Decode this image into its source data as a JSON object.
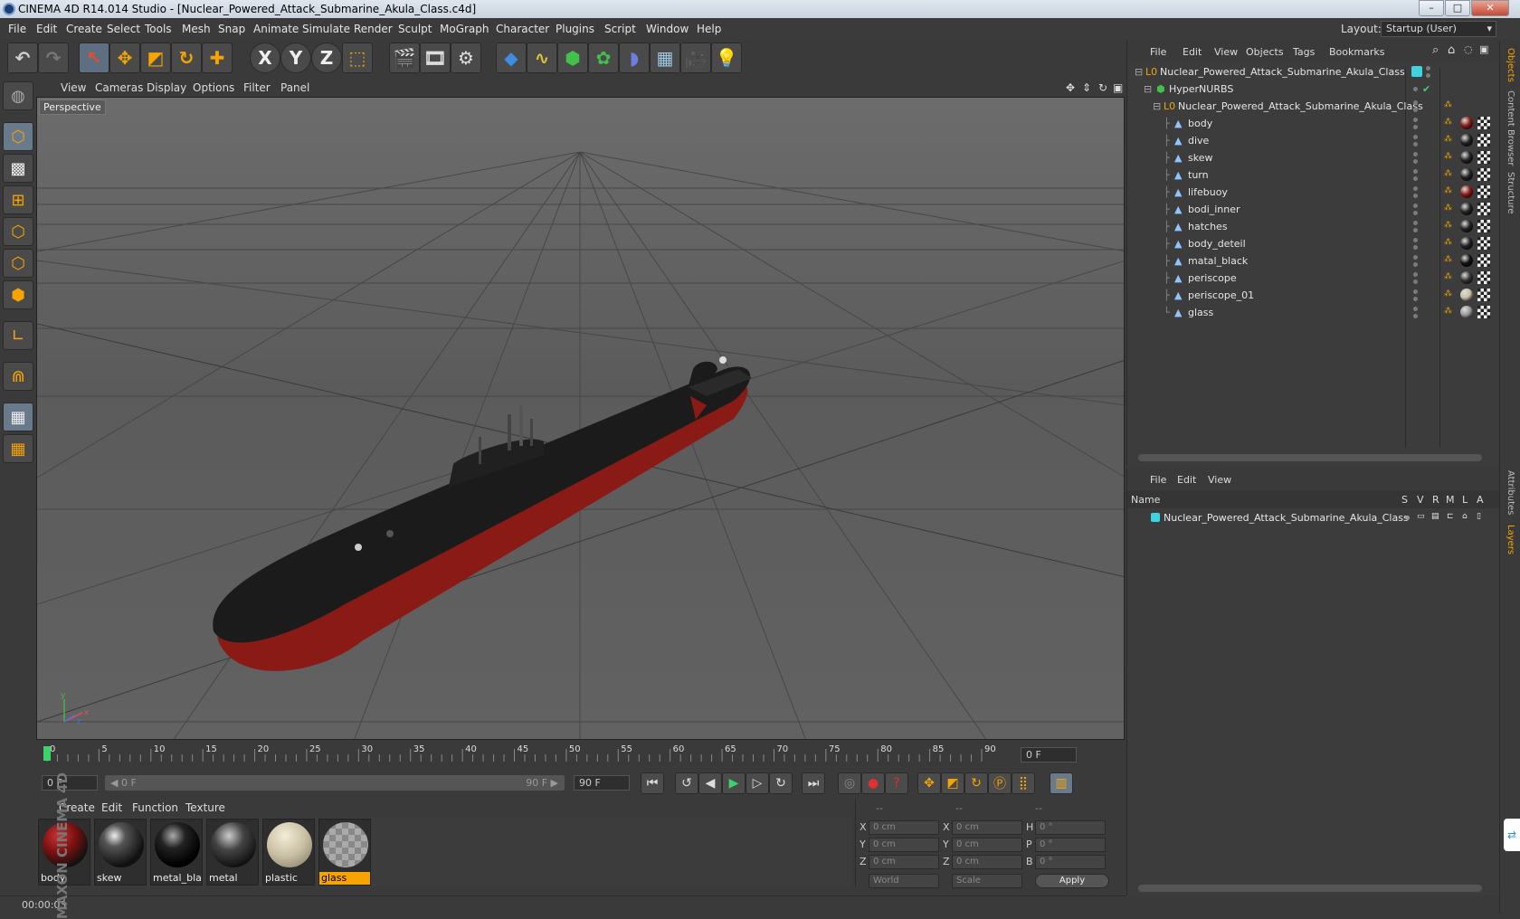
{
  "window": {
    "title": "CINEMA 4D R14.014 Studio - [Nuclear_Powered_Attack_Submarine_Akula_Class.c4d]",
    "minimize": "–",
    "maximize": "□",
    "close": "✕"
  },
  "menubar": {
    "items": [
      "File",
      "Edit",
      "Create",
      "Select",
      "Tools",
      "Mesh",
      "Snap",
      "Animate",
      "Simulate",
      "Render",
      "Sculpt",
      "MoGraph",
      "Character",
      "Plugins",
      "Script",
      "Window",
      "Help"
    ],
    "layout_label": "Layout:",
    "layout_value": "Startup (User)"
  },
  "toolbar": {
    "icons": [
      "undo-icon",
      "redo-icon",
      "live-select-icon",
      "move-icon",
      "scale-icon",
      "rotate-icon",
      "add-icon",
      "x-axis-icon",
      "y-axis-icon",
      "z-axis-icon",
      "coordinate-system-icon",
      "render-view-icon",
      "render-picture-viewer-icon",
      "edit-render-settings-icon",
      "cube-icon",
      "spline-pen-icon",
      "subdivision-icon",
      "array-icon",
      "deformer-icon",
      "floor-icon",
      "camera-icon",
      "light-icon"
    ],
    "axis_x": "X",
    "axis_y": "Y",
    "axis_z": "Z"
  },
  "viewport": {
    "menu": [
      "View",
      "Cameras",
      "Display",
      "Options",
      "Filter",
      "Panel"
    ],
    "label": "Perspective",
    "axis_x": "x",
    "axis_y": "y",
    "axis_z": "z"
  },
  "timeline": {
    "ticks": [
      "0",
      "5",
      "10",
      "15",
      "20",
      "25",
      "30",
      "35",
      "40",
      "45",
      "50",
      "55",
      "60",
      "65",
      "70",
      "75",
      "80",
      "85",
      "90"
    ],
    "current_frame": "0 F",
    "start_frame": "0 F",
    "range_start": "◀ 0 F",
    "range_end": "90 F ▶",
    "end_frame": "90 F",
    "max_frames": 90
  },
  "materials": {
    "menu": [
      "Create",
      "Edit",
      "Function",
      "Texture"
    ],
    "items": [
      {
        "name": "body",
        "selected": false
      },
      {
        "name": "skew",
        "selected": false
      },
      {
        "name": "metal_blacl",
        "selected": false
      },
      {
        "name": "metal",
        "selected": false
      },
      {
        "name": "plastic",
        "selected": false
      },
      {
        "name": "glass",
        "selected": true
      }
    ]
  },
  "coordinates": {
    "headers": [
      "--",
      "--",
      "--"
    ],
    "rows": [
      {
        "a": "X",
        "av": "0 cm",
        "b": "X",
        "bv": "0 cm",
        "c": "H",
        "cv": "0 °"
      },
      {
        "a": "Y",
        "av": "0 cm",
        "b": "Y",
        "bv": "0 cm",
        "c": "P",
        "cv": "0 °"
      },
      {
        "a": "Z",
        "av": "0 cm",
        "b": "Z",
        "bv": "0 cm",
        "c": "B",
        "cv": "0 °"
      }
    ],
    "world": "World",
    "scale": "Scale",
    "apply": "Apply"
  },
  "status": {
    "time": "00:00:03"
  },
  "objects_panel": {
    "menu": [
      "File",
      "Edit",
      "View",
      "Objects",
      "Tags",
      "Bookmarks"
    ],
    "root": "Nuclear_Powered_Attack_Submarine_Akula_Class",
    "hypernurbs": "HyperNURBS",
    "group": "Nuclear_Powered_Attack_Submarine_Akula_Class",
    "children": [
      "body",
      "dive",
      "skew",
      "turn",
      "lifebuoy",
      "bodi_inner",
      "hatches",
      "body_deteil",
      "matal_black",
      "periscope",
      "periscope_01",
      "glass"
    ],
    "check": "✔"
  },
  "layers_panel": {
    "menu": [
      "File",
      "Edit",
      "View"
    ],
    "columns": [
      "Name",
      "S",
      "V",
      "R",
      "M",
      "L",
      "A"
    ],
    "layer": "Nuclear_Powered_Attack_Submarine_Akula_Class"
  },
  "right_tabs": [
    "Objects",
    "Content Browser",
    "Structure",
    "Attributes",
    "Layers"
  ],
  "colors": {
    "accent_orange": "#f6a400",
    "layer_cyan": "#3fd3e0",
    "hull_red": "#8a1a16"
  },
  "brand": "MAXON CINEMA 4D"
}
